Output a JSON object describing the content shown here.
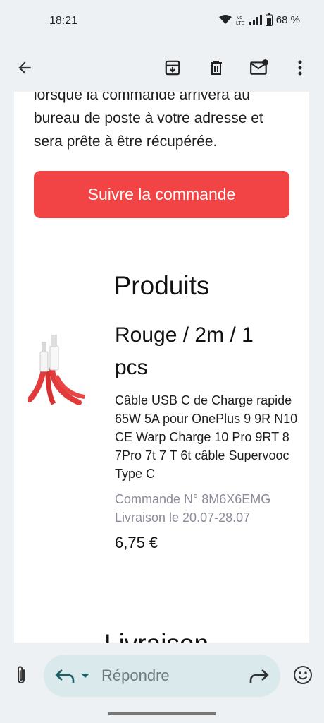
{
  "status_bar": {
    "time": "18:21",
    "volte": "Vo\nLTE",
    "battery": "68 %",
    "icons": [
      "wifi-icon",
      "volte-icon",
      "signal-icon",
      "battery-icon"
    ]
  },
  "app_bar": {
    "icons": [
      "back-arrow-icon",
      "archive-icon",
      "delete-icon",
      "mark-unread-icon",
      "more-vert-icon"
    ]
  },
  "email": {
    "intro": "lorsque la commande arrivera au bureau de poste à votre adresse et sera prête à être récupérée.",
    "track_button": "Suivre la commande",
    "products_title": "Produits",
    "product": {
      "variant": "Rouge / 2m / 1 pcs",
      "description": "Câble USB C de Charge rapide 65W 5A pour OnePlus 9 9R N10 CE Warp Charge 10 Pro 9RT 8 7Pro 7t 7 T 6t câble Supervooc Type C",
      "order_number": "Commande N° 8M6X6EMG",
      "delivery": "Livraison le 20.07-28.07",
      "price": "6,75 €",
      "image_icon": "usb-c-cable-image"
    },
    "next_section_partial": "Livraison"
  },
  "reply_bar": {
    "placeholder": "Répondre",
    "icons": [
      "attach-icon",
      "reply-icon",
      "chevron-down-icon",
      "forward-icon",
      "emoji-icon"
    ]
  },
  "colors": {
    "accent_button": "#f24444",
    "background": "#eef1f4",
    "reply_pill": "#d9e9ec",
    "meta_text": "#8b8b9a"
  }
}
